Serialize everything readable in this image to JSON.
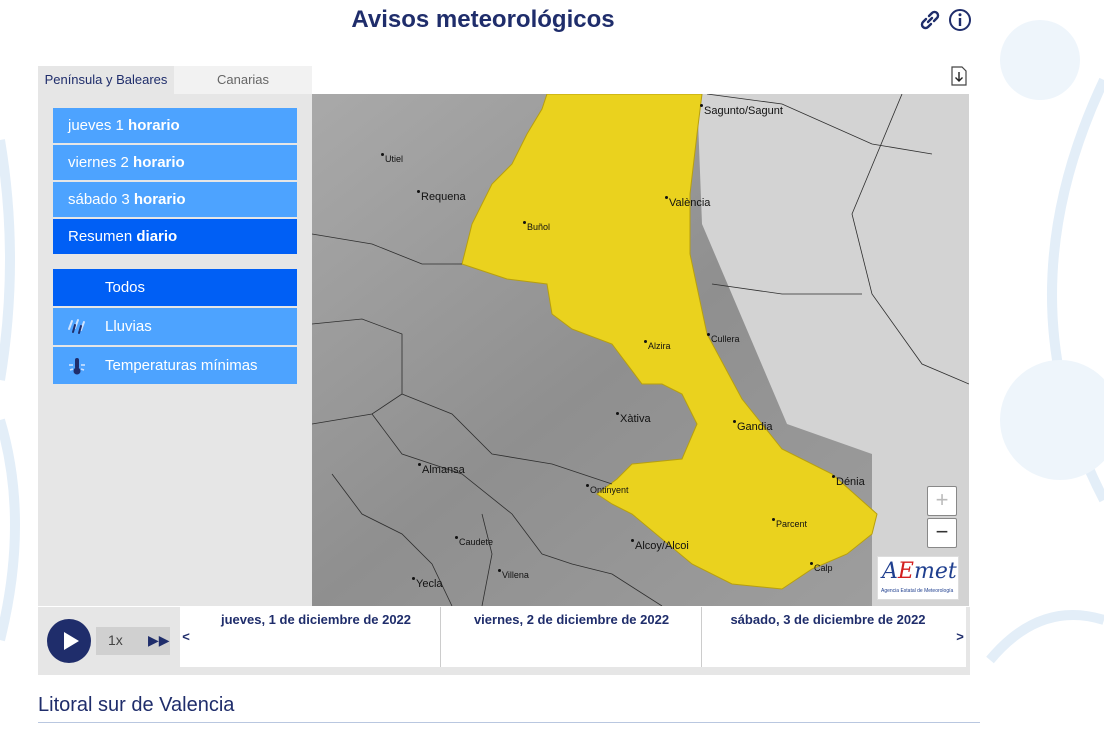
{
  "page": {
    "title": "Avisos meteorológicos"
  },
  "header": {
    "icons": [
      "link-icon",
      "info-icon"
    ]
  },
  "tabs": [
    {
      "label": "Península y Baleares",
      "active": true
    },
    {
      "label": "Canarias",
      "active": false
    }
  ],
  "day_buttons": [
    {
      "pre": "jueves 1 ",
      "strong": "horario"
    },
    {
      "pre": "viernes 2 ",
      "strong": "horario"
    },
    {
      "pre": "sábado 3 ",
      "strong": "horario"
    },
    {
      "pre": "Resumen ",
      "strong": "diario",
      "selected": true
    }
  ],
  "filters": [
    {
      "label": "Todos",
      "icon": "",
      "selected": true
    },
    {
      "label": "Lluvias",
      "icon": "rain-icon"
    },
    {
      "label": "Temperaturas mínimas",
      "icon": "thermometer-icon"
    }
  ],
  "map": {
    "towns": [
      "Sagunto/Sagunt",
      "Utiel",
      "Requena",
      "València",
      "Buñol",
      "Cullera",
      "Alzira",
      "Xàtiva",
      "Gandia",
      "Almansa",
      "Ontinyent",
      "Dénia",
      "Parcent",
      "Caudete",
      "Alcoy/Alcoi",
      "Villena",
      "Calp",
      "Yecla"
    ],
    "warning_color": "#ead21e",
    "zoom_in": "+",
    "zoom_out": "−",
    "logo_text": "AEmet",
    "logo_subtitle": "Agencia Estatal de Meteorología"
  },
  "timeline": {
    "speed": "1x",
    "prev": "<",
    "next": ">",
    "days": [
      "jueves, 1 de diciembre de 2022",
      "viernes, 2 de diciembre de 2022",
      "sábado, 3 de diciembre de 2022"
    ]
  },
  "zone": {
    "title": "Litoral sur de Valencia"
  },
  "colors": {
    "brand": "#1f2d6b",
    "button": "#4da3ff",
    "button_selected": "#005ff5"
  }
}
